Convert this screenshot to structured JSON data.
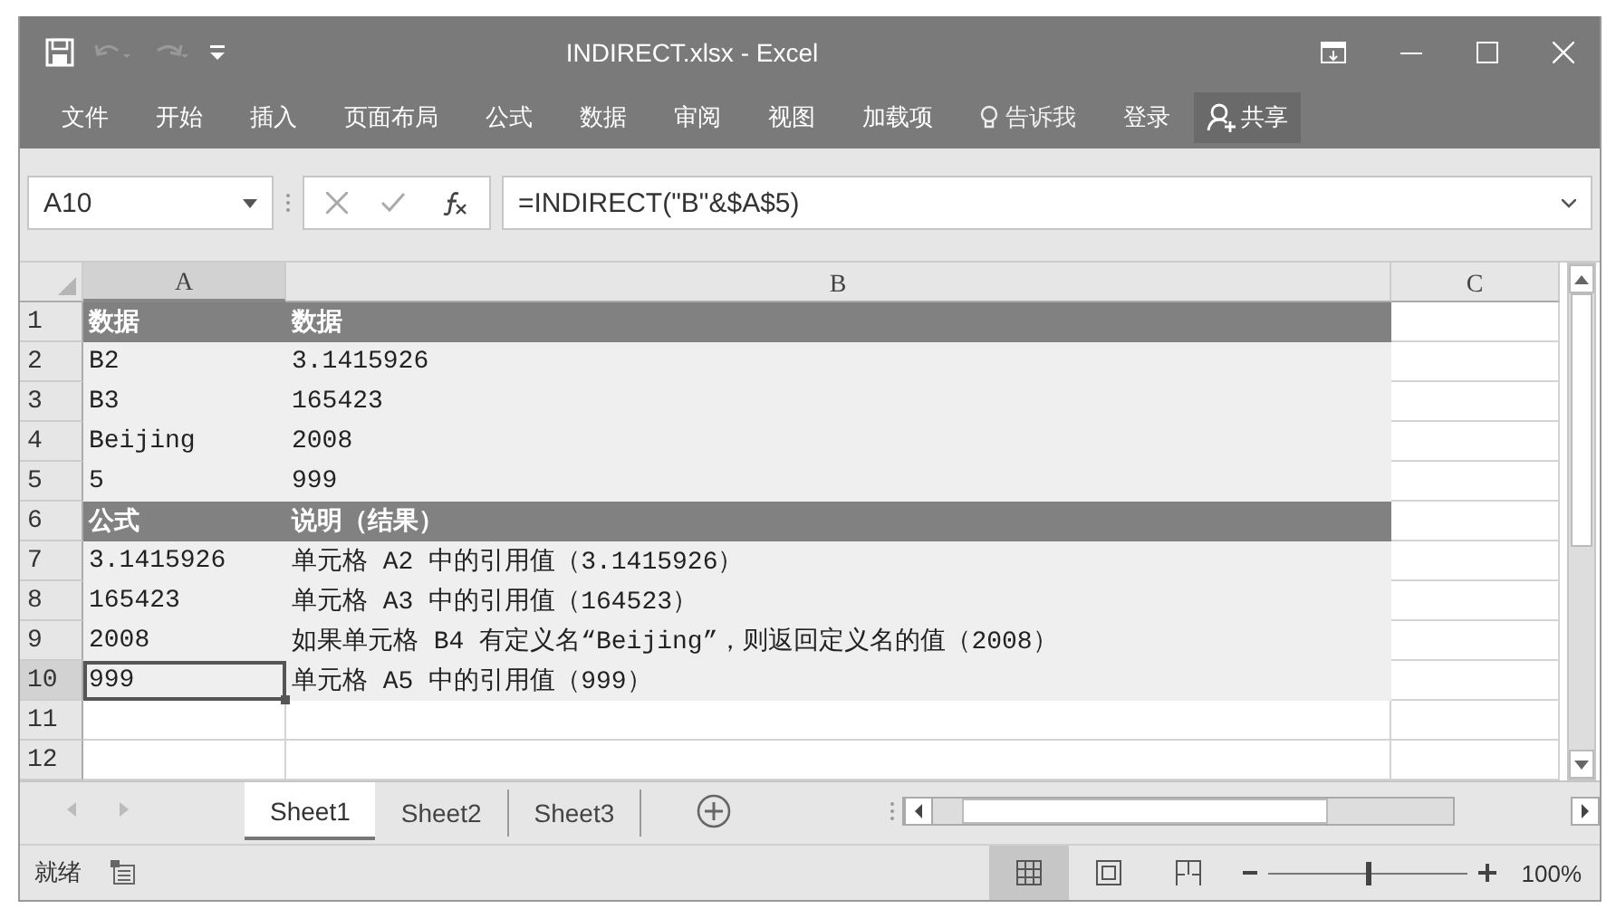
{
  "window": {
    "title": "INDIRECT.xlsx - Excel"
  },
  "ribbon_tabs": [
    "文件",
    "开始",
    "插入",
    "页面布局",
    "公式",
    "数据",
    "审阅",
    "视图",
    "加载项"
  ],
  "tell_me": "告诉我",
  "sign_in": "登录",
  "share": "共享",
  "formula_bar": {
    "name_box": "A10",
    "formula": "=INDIRECT(\"B\"&$A$5)"
  },
  "columns": [
    {
      "label": "A",
      "selected": true
    },
    {
      "label": "B",
      "selected": false
    },
    {
      "label": "C",
      "selected": false
    }
  ],
  "rows": [
    {
      "number": "1",
      "kind": "header",
      "selected": false,
      "cells": [
        "数据",
        "数据"
      ]
    },
    {
      "number": "2",
      "kind": "data",
      "selected": false,
      "cells": [
        "B2",
        "3.1415926"
      ]
    },
    {
      "number": "3",
      "kind": "data",
      "selected": false,
      "cells": [
        "B3",
        "165423"
      ]
    },
    {
      "number": "4",
      "kind": "data",
      "selected": false,
      "cells": [
        "Beijing",
        "2008"
      ]
    },
    {
      "number": "5",
      "kind": "data",
      "selected": false,
      "cells": [
        "5",
        "999"
      ]
    },
    {
      "number": "6",
      "kind": "header",
      "selected": false,
      "cells": [
        "公式",
        "说明（结果）"
      ]
    },
    {
      "number": "7",
      "kind": "data",
      "selected": false,
      "cells": [
        "3.1415926",
        "单元格 A2 中的引用值（3.1415926）"
      ]
    },
    {
      "number": "8",
      "kind": "data",
      "selected": false,
      "cells": [
        "165423",
        "单元格 A3 中的引用值（164523）"
      ]
    },
    {
      "number": "9",
      "kind": "data",
      "selected": false,
      "cells": [
        "2008",
        "如果单元格 B4 有定义名“Beijing”，则返回定义名的值（2008）"
      ]
    },
    {
      "number": "10",
      "kind": "data",
      "selected": true,
      "cells": [
        "999",
        "单元格 A5 中的引用值（999）"
      ]
    },
    {
      "number": "11",
      "kind": "empty",
      "selected": false
    },
    {
      "number": "12",
      "kind": "empty",
      "selected": false
    }
  ],
  "sheet_tabs": [
    {
      "label": "Sheet1",
      "selected": true
    },
    {
      "label": "Sheet2",
      "selected": false
    },
    {
      "label": "Sheet3",
      "selected": false
    }
  ],
  "status_bar": {
    "status": "就绪",
    "views": [
      {
        "kind": "normal",
        "selected": true
      },
      {
        "kind": "page-layout",
        "selected": false
      },
      {
        "kind": "page-break",
        "selected": false
      }
    ],
    "zoom": {
      "level": 0.5,
      "reading": "100%"
    }
  }
}
